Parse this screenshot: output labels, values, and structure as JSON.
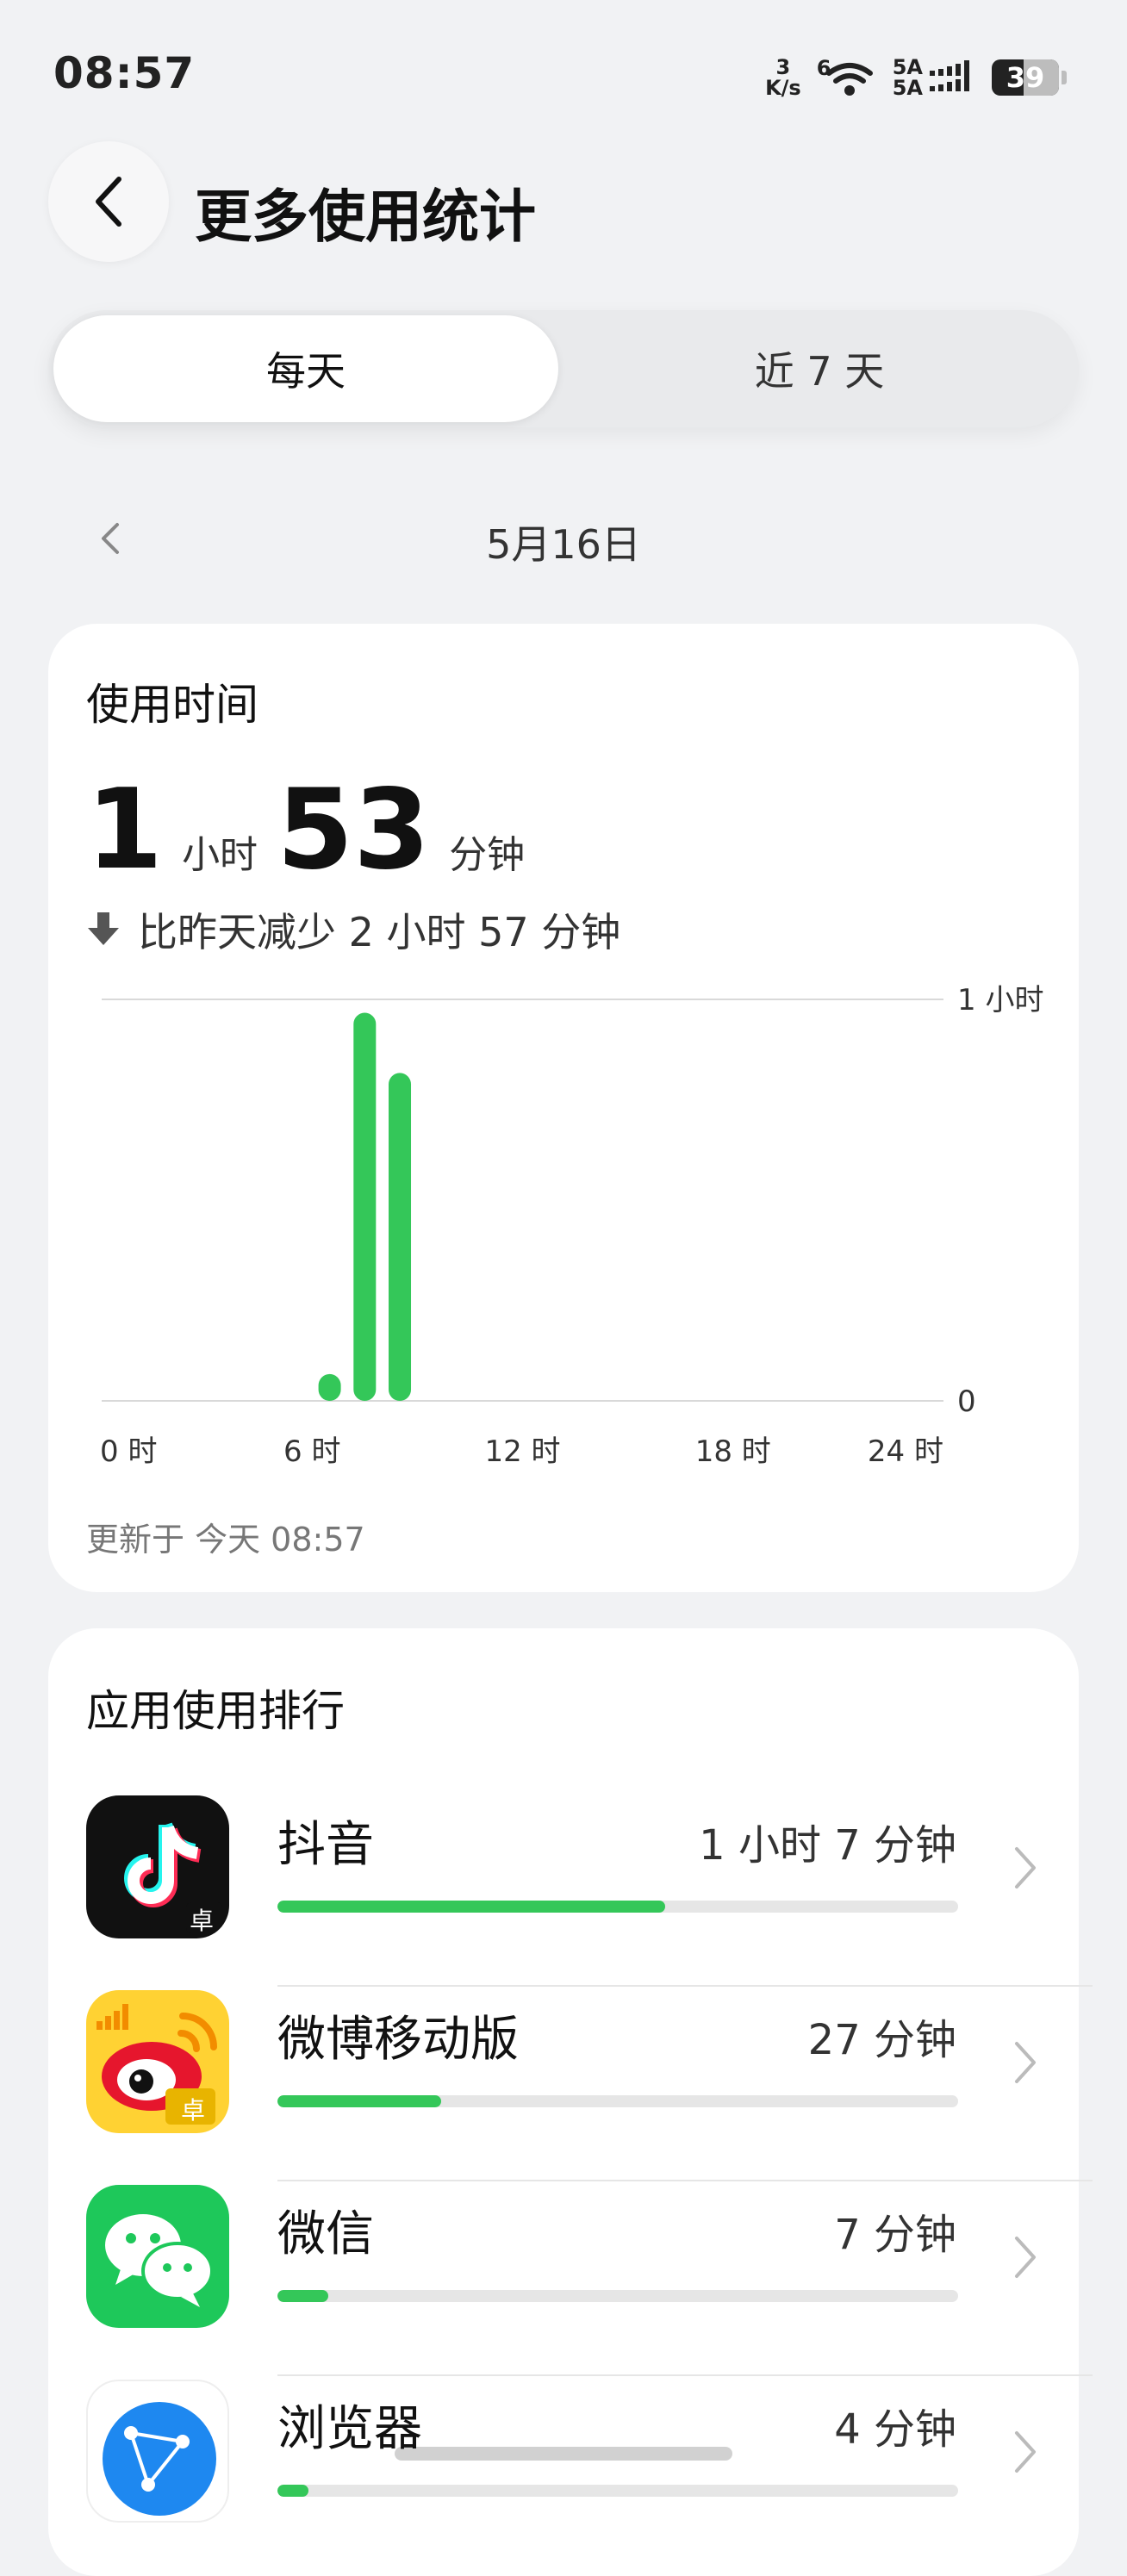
{
  "status_bar": {
    "time": "08:57",
    "net_speed_value": "3",
    "net_speed_unit": "K/s",
    "wifi_label": "6",
    "sim1": "5A",
    "sim2": "5A",
    "battery": "39"
  },
  "header": {
    "title": "更多使用统计"
  },
  "tabs": [
    {
      "label": "每天",
      "active": true
    },
    {
      "label": "近 7 天",
      "active": false
    }
  ],
  "date_nav": {
    "date": "5月16日"
  },
  "usage": {
    "heading": "使用时间",
    "hours": "1",
    "hours_unit": "小时",
    "minutes": "53",
    "minutes_unit": "分钟",
    "compare_text": "比昨天减少 2 小时 57 分钟",
    "updated_text": "更新于 今天 08:57"
  },
  "chart_data": {
    "type": "bar",
    "title": "",
    "xlabel": "",
    "ylabel": "",
    "x_ticks": [
      "0 时",
      "6 时",
      "12 时",
      "18 时",
      "24 时"
    ],
    "y_ticks": [
      "1 小时",
      "0"
    ],
    "xlim": [
      0,
      24
    ],
    "ylim": [
      0,
      60
    ],
    "grid": true,
    "color": "#34c759",
    "x": [
      6,
      7,
      8
    ],
    "values": [
      4,
      58,
      49
    ],
    "y_unit": "minutes"
  },
  "ranking": {
    "heading": "应用使用排行",
    "apps": [
      {
        "name": "抖音",
        "time": "1 小时 7 分钟",
        "fraction": 0.57,
        "icon": "douyin-icon"
      },
      {
        "name": "微博移动版",
        "time": "27 分钟",
        "fraction": 0.24,
        "icon": "weibo-icon"
      },
      {
        "name": "微信",
        "time": "7 分钟",
        "fraction": 0.075,
        "icon": "wechat-icon"
      },
      {
        "name": "浏览器",
        "time": "4 分钟",
        "fraction": 0.045,
        "icon": "browser-icon"
      }
    ],
    "badge": "卓"
  },
  "colors": {
    "accent": "#34c759",
    "background": "#f1f2f4",
    "card": "#ffffff"
  }
}
